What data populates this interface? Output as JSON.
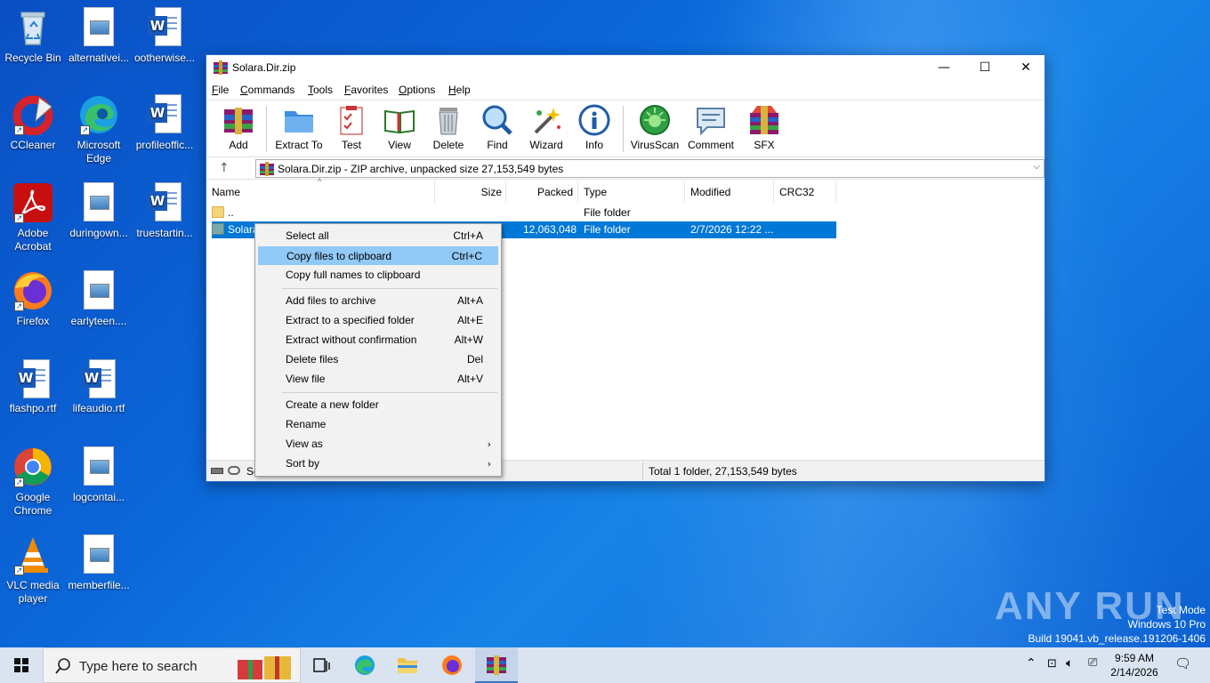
{
  "desktop": {
    "icons": [
      {
        "label": "Recycle Bin",
        "icon": "recycle-bin-icon"
      },
      {
        "label": "alternativei...",
        "icon": "image-document-icon"
      },
      {
        "label": "ootherwise...",
        "icon": "word-document-icon"
      },
      {
        "label": "CCleaner",
        "icon": "ccleaner-icon"
      },
      {
        "label": "Microsoft Edge",
        "icon": "edge-icon"
      },
      {
        "label": "profileoffic...",
        "icon": "word-document-icon"
      },
      {
        "label": "Adobe Acrobat",
        "icon": "acrobat-icon"
      },
      {
        "label": "duringown...",
        "icon": "image-document-icon"
      },
      {
        "label": "truestartin...",
        "icon": "word-document-icon"
      },
      {
        "label": "Firefox",
        "icon": "firefox-icon"
      },
      {
        "label": "earlyteen....",
        "icon": "image-document-icon"
      },
      {
        "label": "flashpo.rtf",
        "icon": "word-document-icon"
      },
      {
        "label": "lifeaudio.rtf",
        "icon": "word-document-icon"
      },
      {
        "label": "Google Chrome",
        "icon": "chrome-icon"
      },
      {
        "label": "logcontai...",
        "icon": "image-document-icon"
      },
      {
        "label": "VLC media player",
        "icon": "vlc-icon"
      },
      {
        "label": "memberfile...",
        "icon": "image-document-icon"
      }
    ],
    "watermark": "ANY RUN",
    "sysinfo": {
      "line1": "Test Mode",
      "line2": "Windows 10 Pro",
      "line3": "Build 19041.vb_release.191206-1406"
    }
  },
  "window": {
    "title": "Solara.Dir.zip",
    "menu": [
      "File",
      "Commands",
      "Tools",
      "Favorites",
      "Options",
      "Help"
    ],
    "toolbar": [
      "Add",
      "Extract To",
      "Test",
      "View",
      "Delete",
      "Find",
      "Wizard",
      "Info",
      "VirusScan",
      "Comment",
      "SFX"
    ],
    "address": "Solara.Dir.zip - ZIP archive, unpacked size 27,153,549 bytes",
    "columns": [
      "Name",
      "Size",
      "Packed",
      "Type",
      "Modified",
      "CRC32"
    ],
    "rows": [
      {
        "name": "..",
        "size": "",
        "packed": "",
        "type": "File folder",
        "modified": "",
        "crc": ""
      },
      {
        "name": "Solara",
        "size": "",
        "packed": "12,063,048",
        "type": "File folder",
        "modified": "2/7/2026 12:22 ...",
        "crc": ""
      }
    ],
    "status_left": "Se",
    "status_right": "Total 1 folder, 27,153,549 bytes"
  },
  "context_menu": {
    "groups": [
      [
        {
          "label": "Select all",
          "key": "Ctrl+A"
        },
        {
          "label": "Copy files to clipboard",
          "key": "Ctrl+C",
          "highlighted": true
        },
        {
          "label": "Copy full names to clipboard",
          "key": ""
        }
      ],
      [
        {
          "label": "Add files to archive",
          "key": "Alt+A"
        },
        {
          "label": "Extract to a specified folder",
          "key": "Alt+E"
        },
        {
          "label": "Extract without confirmation",
          "key": "Alt+W"
        },
        {
          "label": "Delete files",
          "key": "Del"
        },
        {
          "label": "View file",
          "key": "Alt+V"
        }
      ],
      [
        {
          "label": "Create a new folder",
          "key": ""
        },
        {
          "label": "Rename",
          "key": ""
        },
        {
          "label": "View as",
          "key": "",
          "submenu": true
        },
        {
          "label": "Sort by",
          "key": "",
          "submenu": true
        }
      ]
    ]
  },
  "taskbar": {
    "search_placeholder": "Type here to search",
    "time": "9:59 AM",
    "date": "2/14/2026"
  }
}
